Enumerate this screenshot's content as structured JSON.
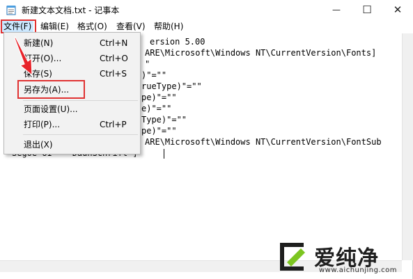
{
  "window": {
    "title": "新建文本文档.txt - 记事本",
    "minimize_glyph": "—",
    "maximize_glyph": "☐",
    "close_glyph": "✕"
  },
  "menubar": {
    "items": [
      "文件(F)",
      "编辑(E)",
      "格式(O)",
      "查看(V)",
      "帮助(H)"
    ],
    "active_index": 0
  },
  "file_menu": {
    "items": [
      {
        "label": "新建(N)",
        "shortcut": "Ctrl+N"
      },
      {
        "label": "打开(O)...",
        "shortcut": "Ctrl+O"
      },
      {
        "label": "保存(S)",
        "shortcut": "Ctrl+S"
      },
      {
        "label": "另存为(A)...",
        "shortcut": ""
      },
      {
        "label": "页面设置(U)...",
        "shortcut": ""
      },
      {
        "label": "打印(P)...",
        "shortcut": "Ctrl+P"
      },
      {
        "label": "退出(X)",
        "shortcut": ""
      }
    ],
    "highlighted_item": "另存为(A)..."
  },
  "editor": {
    "lines": [
      "ersion 5.00",
      "ARE\\Microsoft\\Windows NT\\CurrentVersion\\Fonts]",
      "\"",
      ")\"=\"\"",
      "rueType)\"=\"\"",
      "pe)\"=\"\"",
      "e)\"=\"\"",
      "Type)\"=\"\"",
      "pe)\"=\"\"",
      "ARE\\Microsoft\\Windows NT\\CurrentVersion\\FontSub",
      "Segoe UI    DaunSchrift\"]"
    ]
  },
  "watermark": {
    "brand": "爱纯净",
    "url": "www.aichunjing.com"
  },
  "colors": {
    "annotation_red": "#e03131",
    "menu_active_bg": "#cce8ff",
    "dropdown_bg": "#f2f2f2"
  }
}
